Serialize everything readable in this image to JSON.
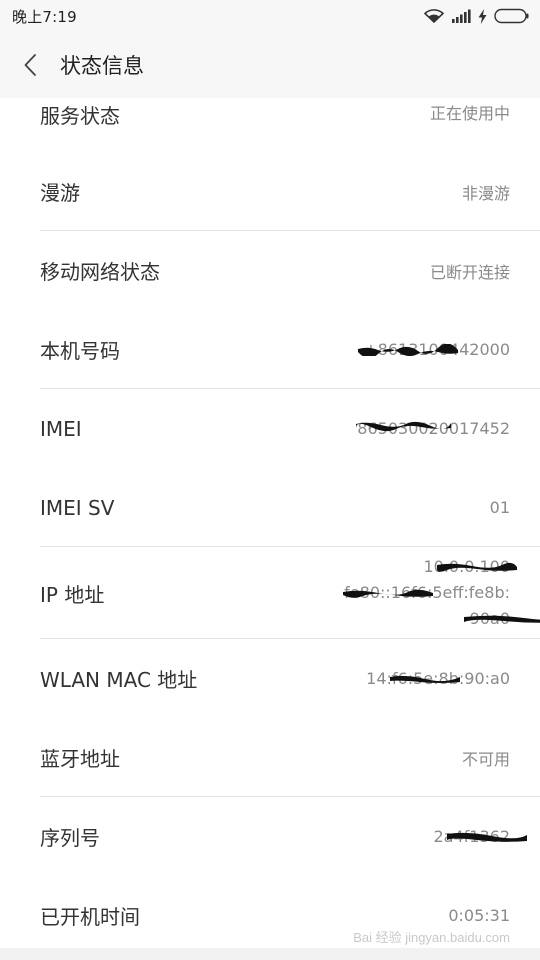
{
  "status_bar": {
    "time": "晚上7:19",
    "icons": [
      "wifi-icon",
      "signal-icon",
      "charging-icon",
      "battery-icon"
    ]
  },
  "header": {
    "title": "状态信息",
    "back_icon": "chevron-left-icon"
  },
  "rows": [
    {
      "label": "服务状态",
      "value": "正在使用中"
    },
    {
      "label": "漫游",
      "value": "非漫游"
    },
    {
      "label": "移动网络状态",
      "value": "已断开连接"
    },
    {
      "label": "本机号码",
      "value": "+8613100442000"
    },
    {
      "label": "IMEI",
      "value": "865030020017452"
    },
    {
      "label": "IMEI SV",
      "value": "01"
    },
    {
      "label": "IP 地址",
      "value_lines": [
        "10.0.0.100",
        "fe80::16f6:5eff:fe8b:",
        "90a0"
      ]
    },
    {
      "label": "WLAN MAC 地址",
      "value": "14:f6:5e:8b:90:a0"
    },
    {
      "label": "蓝牙地址",
      "value": "不可用"
    },
    {
      "label": "序列号",
      "value": "2a4f1362"
    },
    {
      "label": "已开机时间",
      "value": "0:05:31"
    }
  ],
  "watermark": "Bai 经验 jingyan.baidu.com",
  "colors": {
    "bar_bg": "#f7f7f7",
    "label": "#333333",
    "value": "#8a8a8a",
    "divider": "#e3e3e3"
  }
}
